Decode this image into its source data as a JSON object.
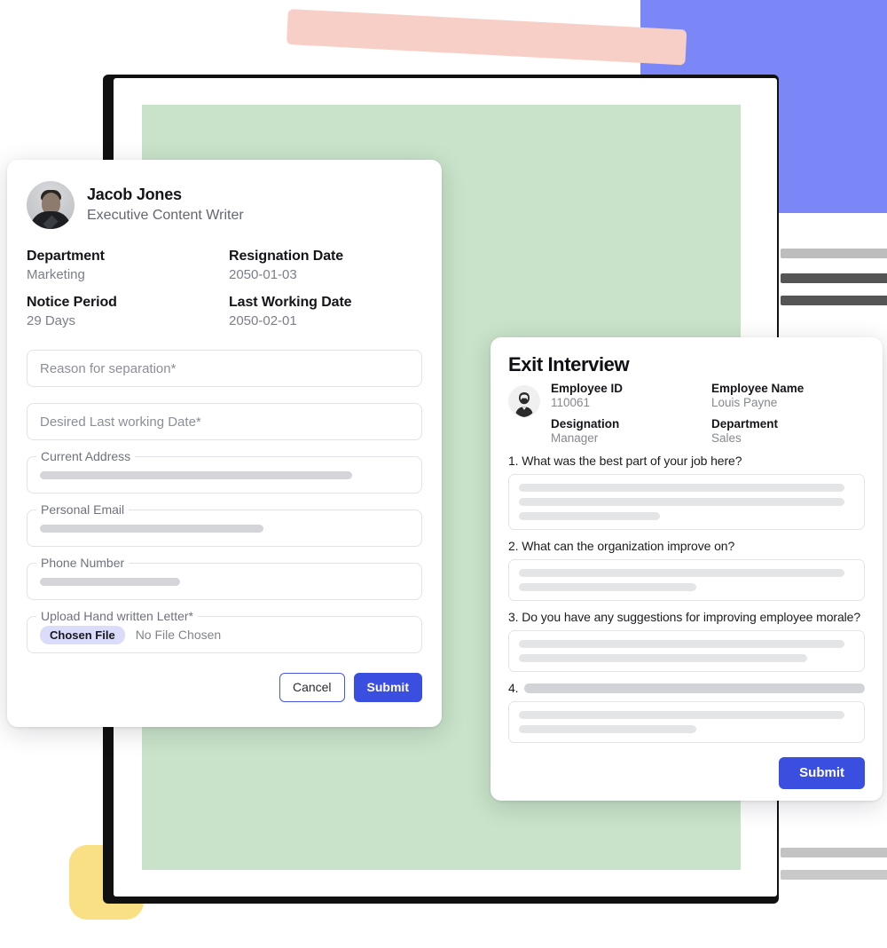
{
  "colors": {
    "accent_blue": "#3a4ee0",
    "deco_blue": "#7b86f7",
    "deco_pink": "#f8cfc6",
    "deco_yellow": "#fae084",
    "panel_green": "#c8e3c9",
    "chip_lavender": "#dadcfa"
  },
  "resignation_card": {
    "profile": {
      "name": "Jacob Jones",
      "role": "Executive Content Writer",
      "avatar_icon": "user-photo-avatar"
    },
    "meta": [
      {
        "label": "Department",
        "value": "Marketing"
      },
      {
        "label": "Resignation Date",
        "value": "2050-01-03"
      },
      {
        "label": "Notice Period",
        "value": "29 Days"
      },
      {
        "label": "Last Working Date",
        "value": "2050-02-01"
      }
    ],
    "fields": {
      "reason_placeholder": "Reason for separation*",
      "desired_date_placeholder": "Desired Last working Date*",
      "current_address_label": "Current Address",
      "personal_email_label": "Personal Email",
      "phone_number_label": "Phone Number",
      "upload_label": "Upload Hand written Letter*",
      "chosen_file_button": "Chosen File",
      "chosen_file_status": "No File Chosen"
    },
    "buttons": {
      "cancel": "Cancel",
      "submit": "Submit"
    }
  },
  "exit_interview_card": {
    "title": "Exit Interview",
    "avatar_icon": "person-illustration-avatar",
    "details": [
      {
        "label": "Employee ID",
        "value": "110061"
      },
      {
        "label": "Employee Name",
        "value": "Louis Payne"
      },
      {
        "label": "Designation",
        "value": "Manager"
      },
      {
        "label": "Department",
        "value": "Sales"
      }
    ],
    "questions": [
      {
        "number": "1.",
        "text": "What was the best part of your job here?",
        "redacted": false
      },
      {
        "number": "2.",
        "text": "What can the organization improve on?",
        "redacted": false
      },
      {
        "number": "3.",
        "text": "Do you have any suggestions for improving employee morale?",
        "redacted": false
      },
      {
        "number": "4.",
        "text": "",
        "redacted": true
      }
    ],
    "submit_label": "Submit"
  }
}
